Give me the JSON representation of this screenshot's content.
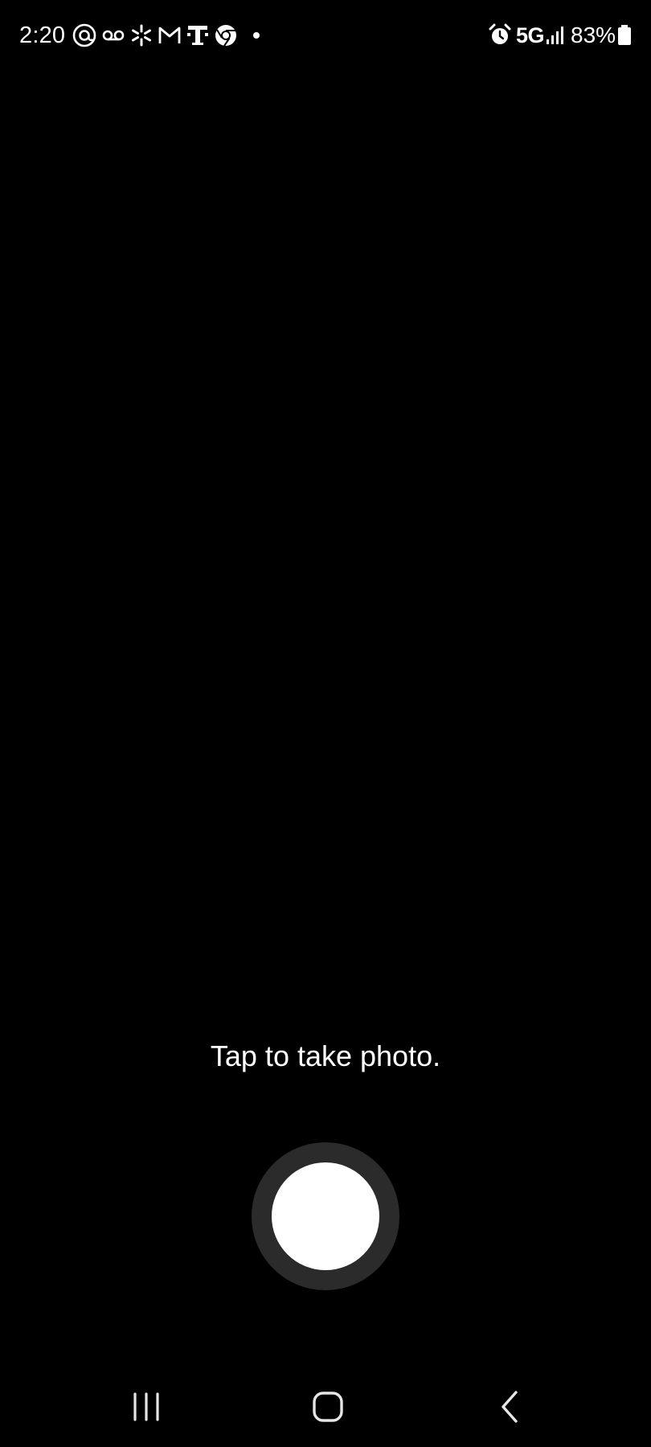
{
  "status_bar": {
    "time": "2:20",
    "network": "5G",
    "battery": "83%",
    "icons": [
      "threads-icon",
      "voicemail-icon",
      "walmart-spark-icon",
      "gmail-icon",
      "tmobile-icon",
      "chrome-icon",
      "notification-dot-icon",
      "alarm-icon",
      "signal-icon",
      "battery-icon"
    ]
  },
  "camera": {
    "hint": "Tap to take photo."
  },
  "nav_bar": {
    "icons": [
      "recents-icon",
      "home-icon",
      "back-icon"
    ]
  },
  "colors": {
    "background": "#000000",
    "text": "#ffffff",
    "shutter_ring": "#2b2b2b",
    "shutter_center": "#ffffff"
  }
}
